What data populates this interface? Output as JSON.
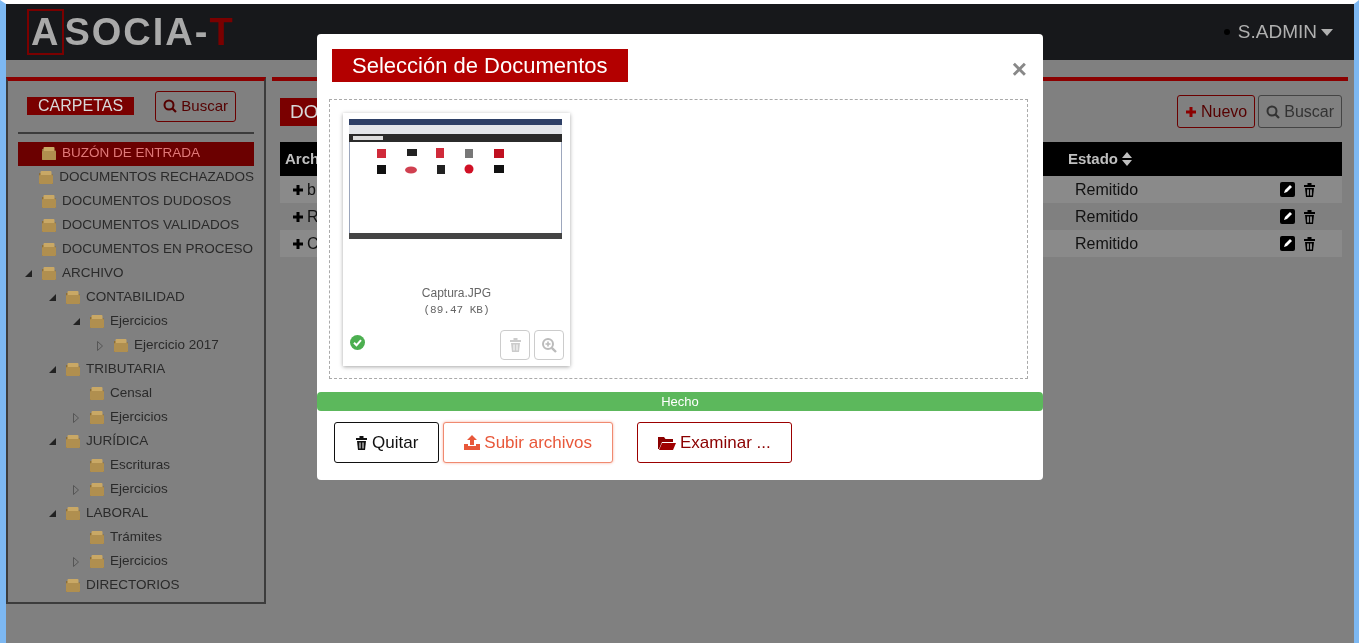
{
  "navbar": {
    "logo": {
      "boxed": "A",
      "middle": "SOCIA-",
      "accent": "T"
    },
    "user_menu": "S.ADMIN"
  },
  "sidebar": {
    "title": "CARPETAS",
    "search_button": "Buscar",
    "tree": [
      {
        "label": "BUZÓN DE ENTRADA",
        "selected": true
      },
      {
        "label": "DOCUMENTOS RECHAZADOS",
        "selected": false
      },
      {
        "label": "DOCUMENTOS DUDOSOS",
        "selected": false
      },
      {
        "label": "DOCUMENTOS VALIDADOS",
        "selected": false
      },
      {
        "label": "DOCUMENTOS EN PROCESO",
        "selected": false
      },
      {
        "label": "ARCHIVO",
        "selected": false,
        "expanded": true,
        "children": [
          {
            "label": "CONTABILIDAD",
            "selected": false,
            "expanded": true,
            "children": [
              {
                "label": "Ejercicios",
                "selected": false,
                "expanded": true,
                "children": [
                  {
                    "label": "Ejercicio 2017",
                    "selected": false,
                    "expanded": false
                  }
                ]
              }
            ]
          },
          {
            "label": "TRIBUTARIA",
            "selected": false,
            "expanded": true,
            "children": [
              {
                "label": "Censal",
                "selected": false
              },
              {
                "label": "Ejercicios",
                "selected": false,
                "expanded": false
              }
            ]
          },
          {
            "label": "JURÍDICA",
            "selected": false,
            "expanded": true,
            "children": [
              {
                "label": "Escrituras",
                "selected": false
              },
              {
                "label": "Ejercicios",
                "selected": false,
                "expanded": false
              }
            ]
          },
          {
            "label": "LABORAL",
            "selected": false,
            "expanded": true,
            "children": [
              {
                "label": "Trámites",
                "selected": false
              },
              {
                "label": "Ejercicios",
                "selected": false,
                "expanded": false
              }
            ]
          },
          {
            "label": "DIRECTORIOS",
            "selected": false
          }
        ]
      }
    ]
  },
  "main": {
    "title": "DO",
    "new_button": "Nuevo",
    "search_button": "Buscar",
    "table": {
      "columns": [
        "Arch",
        "Estado"
      ],
      "rows": [
        {
          "column_1": "b",
          "estado": "Remitido"
        },
        {
          "column_1": "R",
          "estado": "Remitido"
        },
        {
          "column_1": "C",
          "estado": "Remitido"
        }
      ]
    }
  },
  "modal": {
    "title": "Selección de Documentos",
    "close": "×",
    "files": [
      {
        "kind": "picture",
        "name": "Captura.JPG",
        "size": "(89.47 KB)",
        "uploaded": true
      }
    ],
    "progress": {
      "level": 1,
      "label": "Hecho"
    },
    "buttons": [
      {
        "kind": "remove",
        "label": "Quitar"
      },
      {
        "kind": "upload",
        "label": "Subir archivos"
      },
      {
        "kind": "browse",
        "label": "Examinar ..."
      }
    ]
  }
}
